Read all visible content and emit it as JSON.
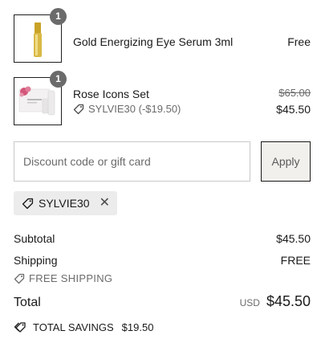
{
  "items": [
    {
      "name": "Gold Energizing Eye Serum 3ml",
      "quantity": "1",
      "price": "Free",
      "thumbnail": "gold-serum-tube-image"
    },
    {
      "name": "Rose Icons Set",
      "quantity": "1",
      "original_price": "$65.00",
      "price": "$45.50",
      "discount_note": "SYLVIE30 (-$19.50)",
      "thumbnail": "rose-icons-set-image"
    }
  ],
  "discount": {
    "placeholder": "Discount code or gift card",
    "value": "",
    "apply_label": "Apply",
    "applied_code": "SYLVIE30"
  },
  "summary": {
    "subtotal_label": "Subtotal",
    "subtotal_value": "$45.50",
    "shipping_label": "Shipping",
    "shipping_value": "FREE",
    "free_shipping_note": "FREE SHIPPING",
    "total_label": "Total",
    "currency": "USD",
    "total_value": "$45.50",
    "savings_label": "TOTAL SAVINGS",
    "savings_value": "$19.50"
  },
  "colors": {
    "muted": "#6b6b6b",
    "chip_bg": "#ececec",
    "badge": "#6b6b6b",
    "apply_bg": "#f2f0ec"
  }
}
